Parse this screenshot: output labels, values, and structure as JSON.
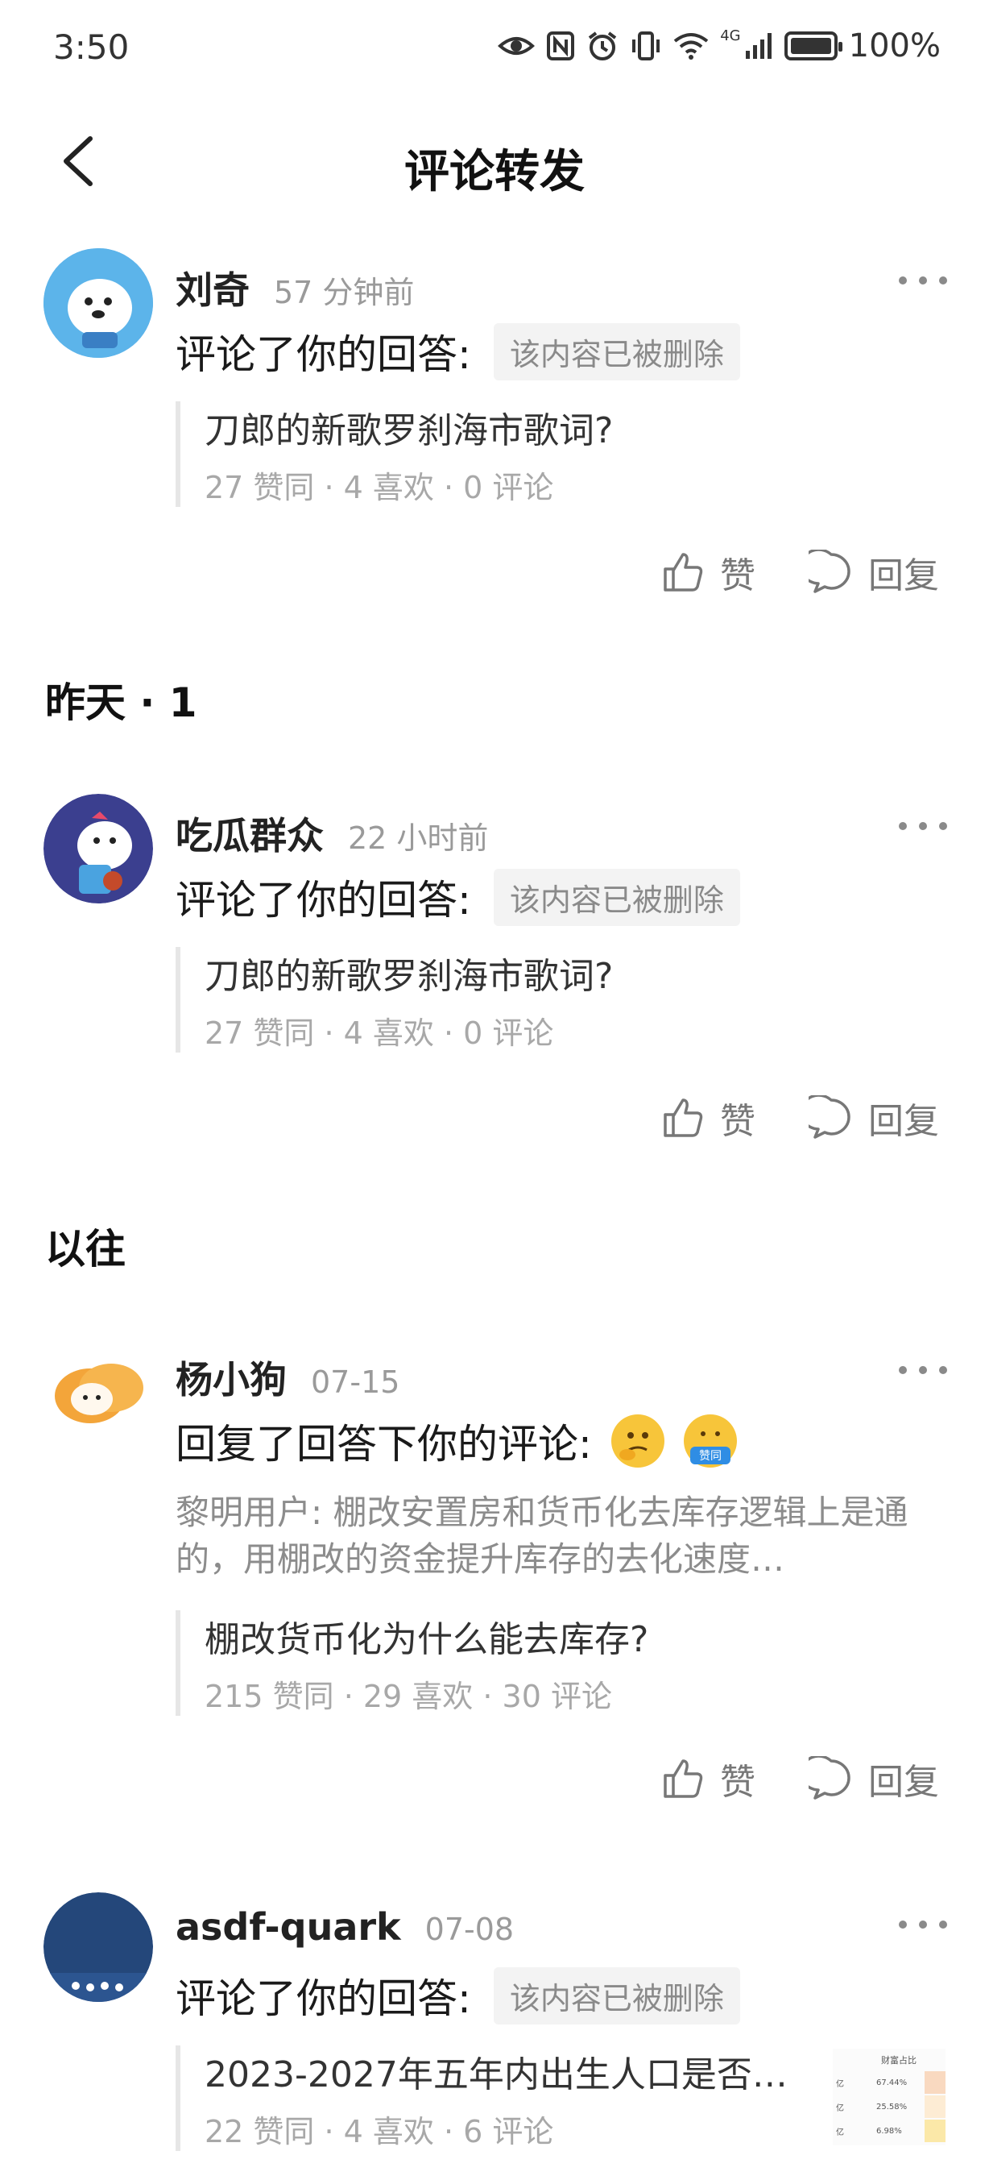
{
  "status_bar": {
    "time": "3:50",
    "network": "4G",
    "battery": "100%"
  },
  "header": {
    "title": "评论转发"
  },
  "sections": {
    "yesterday": "昨天 · 1",
    "past": "以往"
  },
  "actions": {
    "like": "赞",
    "reply": "回复"
  },
  "notifications": [
    {
      "user": "刘奇",
      "time": "57 分钟前",
      "action": "评论了你的回答:",
      "tag": "该内容已被删除",
      "quote_title": "刀郎的新歌罗刹海市歌词?",
      "quote_stats": "27 赞同 · 4 喜欢 · 0 评论"
    },
    {
      "user": "吃瓜群众",
      "time": "22 小时前",
      "action": "评论了你的回答:",
      "tag": "该内容已被删除",
      "quote_title": "刀郎的新歌罗刹海市歌词?",
      "quote_stats": "27 赞同 · 4 喜欢 · 0 评论"
    },
    {
      "user": "杨小狗",
      "time": "07-15",
      "action": "回复了回答下你的评论:",
      "comment": "黎明用户: 棚改安置房和货币化去库存逻辑上是通的，用棚改的资金提升库存的去化速度…",
      "quote_title": "棚改货币化为什么能去库存?",
      "quote_stats": "215 赞同 · 29 喜欢 · 30 评论"
    },
    {
      "user": "asdf-quark",
      "time": "07-08",
      "action": "评论了你的回答:",
      "tag": "该内容已被删除",
      "quote_title": "2023-2027年五年内出生人口是否…",
      "quote_stats": "22 赞同 · 4 喜欢 · 6 评论",
      "thumb_header": "财富占比",
      "thumb_rows": [
        "亿",
        "67.44%",
        "亿",
        "25.58%",
        "亿",
        "6.98%"
      ]
    }
  ],
  "emoji_label": "赞同"
}
